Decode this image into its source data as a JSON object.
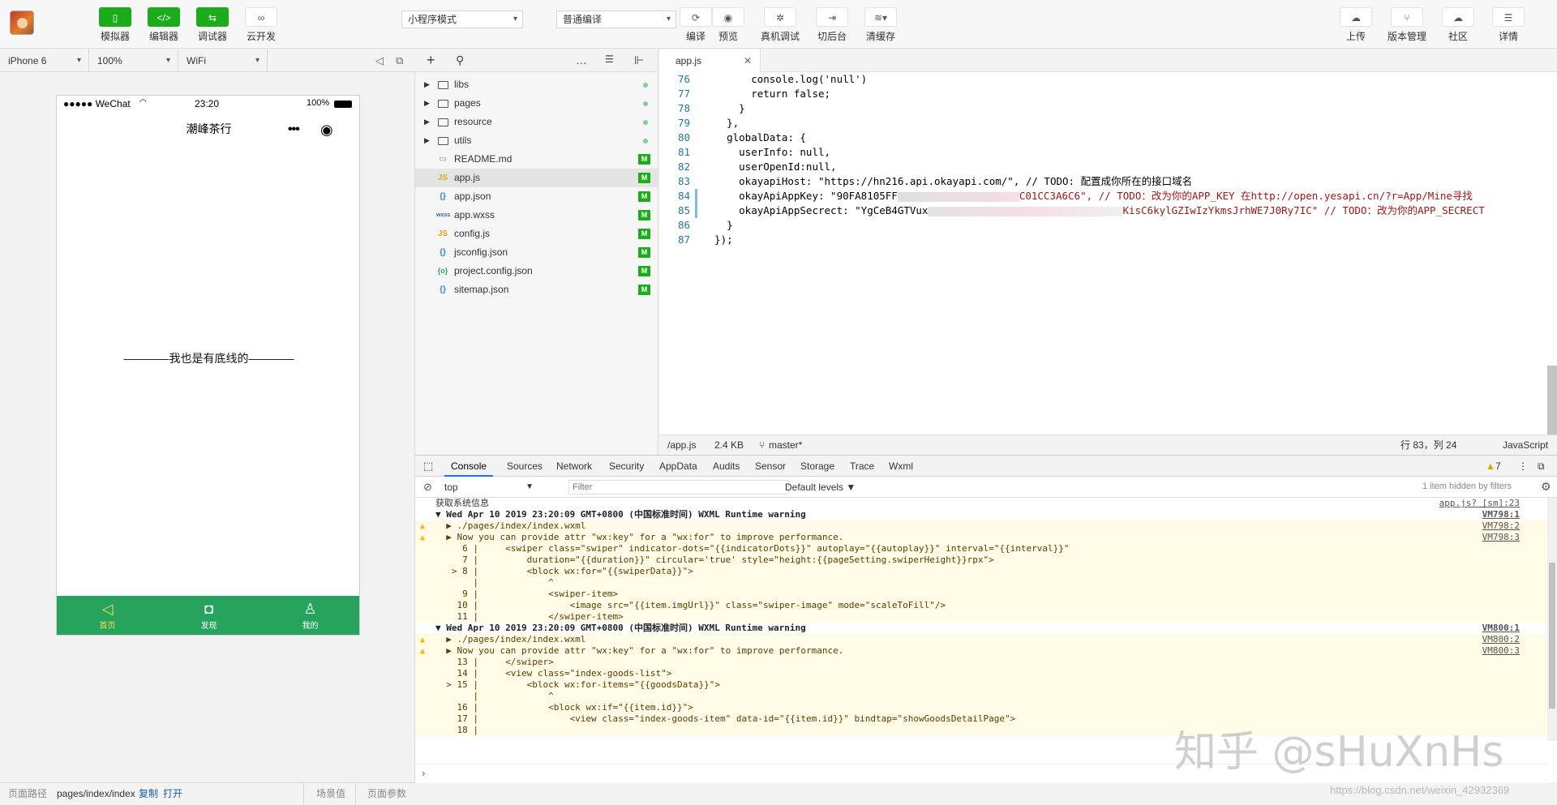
{
  "toolbar": {
    "buttons": [
      "模拟器",
      "编辑器",
      "调试器",
      "云开发"
    ],
    "mode_select": "小程序模式",
    "compile_select": "普通编译",
    "actions": [
      "编译",
      "预览",
      "真机调试",
      "切后台",
      "清缓存"
    ],
    "right_actions": [
      "上传",
      "版本管理",
      "社区",
      "详情"
    ]
  },
  "device": {
    "model": "iPhone 6",
    "zoom": "100%",
    "network": "WiFi"
  },
  "phone": {
    "status_carrier": "●●●●● WeChat",
    "status_time": "23:20",
    "status_battery": "100%",
    "nav_title": "潮峰茶行",
    "center_text": "————我也是有底线的————",
    "tabs": [
      "首页",
      "发现",
      "我的"
    ]
  },
  "sim_footer": {
    "label": "页面路径",
    "path": "pages/index/index",
    "copy": "复制",
    "open": "打开",
    "scene": "场景值",
    "params": "页面参数"
  },
  "explorer": {
    "folders": [
      "libs",
      "pages",
      "resource",
      "utils"
    ],
    "files": [
      {
        "name": "README.md",
        "icon": ""
      },
      {
        "name": "app.js",
        "icon": "JS"
      },
      {
        "name": "app.json",
        "icon": "{}"
      },
      {
        "name": "app.wxss",
        "icon": "wxss"
      },
      {
        "name": "config.js",
        "icon": "JS"
      },
      {
        "name": "jsconfig.json",
        "icon": "{}"
      },
      {
        "name": "project.config.json",
        "icon": "{o}"
      },
      {
        "name": "sitemap.json",
        "icon": "{}"
      }
    ],
    "badge": "M"
  },
  "editor": {
    "tab": "app.js",
    "line_numbers": [
      "76",
      "77",
      "78",
      "79",
      "80",
      "81",
      "82",
      "83",
      "84",
      "85",
      "86",
      "87"
    ],
    "lines": [
      "        console.log('null')",
      "        return false;",
      "      }",
      "    },",
      "    globalData: {",
      "      userInfo: null,",
      "      userOpenId:null,",
      "      okayapiHost: \"https://hn216.api.okayapi.com/\", // TODO: 配置成你所在的接口域名",
      "      okayApiAppKey: \"90FA8105FF",
      "      okayApiAppSecrect: \"YgCeB4GTVux",
      "    }",
      "  });"
    ],
    "line84_rest": "C01CC3A6C6\", // TODO：改为你的APP_KEY 在http://open.yesapi.cn/?r=App/Mine寻找",
    "line85_rest": "KisC6kylGZIwIzYkmsJrhWE7J0Ry7IC\" // TODO：改为你的APP_SECRECT",
    "status": {
      "path": "/app.js",
      "size": "2.4 KB",
      "branch": "master*",
      "position": "行 83，列 24",
      "lang": "JavaScript"
    }
  },
  "devtools": {
    "tabs": [
      "Console",
      "Sources",
      "Network",
      "Security",
      "AppData",
      "Audits",
      "Sensor",
      "Storage",
      "Trace",
      "Wxml"
    ],
    "warn_count": "7",
    "context": "top",
    "filter_placeholder": "Filter",
    "levels": "Default levels",
    "hidden": "1 item hidden by filters",
    "console": [
      {
        "t": "获取系统信息",
        "src": "app.js? [sm]:23",
        "k": "plain"
      },
      {
        "t": "▼ Wed Apr 10 2019 23:20:09 GMT+0800 (中国标准时间) WXML Runtime warning",
        "src": "VM798:1",
        "k": "hdr"
      },
      {
        "t": "  ▶ ./pages/index/index.wxml",
        "src": "VM798:2",
        "k": "warn"
      },
      {
        "t": "  ▶ Now you can provide attr \"wx:key\" for a \"wx:for\" to improve performance.",
        "src": "VM798:3",
        "k": "warn"
      },
      {
        "t": "     6 |     <swiper class=\"swiper\" indicator-dots=\"{{indicatorDots}}\" autoplay=\"{{autoplay}}\" interval=\"{{interval}}\"",
        "src": "",
        "k": "warn"
      },
      {
        "t": "     7 |         duration=\"{{duration}}\" circular='true' style=\"height:{{pageSetting.swiperHeight}}rpx\">",
        "src": "",
        "k": "warn"
      },
      {
        "t": "   > 8 |         <block wx:for=\"{{swiperData}}\">",
        "src": "",
        "k": "warn"
      },
      {
        "t": "       |             ^",
        "src": "",
        "k": "warn"
      },
      {
        "t": "     9 |             <swiper-item>",
        "src": "",
        "k": "warn"
      },
      {
        "t": "    10 |                 <image src=\"{{item.imgUrl}}\" class=\"swiper-image\" mode=\"scaleToFill\"/>",
        "src": "",
        "k": "warn"
      },
      {
        "t": "    11 |             </swiper-item>",
        "src": "",
        "k": "warn"
      },
      {
        "t": "▼ Wed Apr 10 2019 23:20:09 GMT+0800 (中国标准时间) WXML Runtime warning",
        "src": "VM800:1",
        "k": "hdr"
      },
      {
        "t": "  ▶ ./pages/index/index.wxml",
        "src": "VM800:2",
        "k": "warn"
      },
      {
        "t": "  ▶ Now you can provide attr \"wx:key\" for a \"wx:for\" to improve performance.",
        "src": "VM800:3",
        "k": "warn"
      },
      {
        "t": "    13 |     </swiper>",
        "src": "",
        "k": "warn"
      },
      {
        "t": "    14 |     <view class=\"index-goods-list\">",
        "src": "",
        "k": "warn"
      },
      {
        "t": "  > 15 |         <block wx:for-items=\"{{goodsData}}\">",
        "src": "",
        "k": "warn"
      },
      {
        "t": "       |             ^",
        "src": "",
        "k": "warn"
      },
      {
        "t": "    16 |             <block wx:if=\"{{item.id}}\">",
        "src": "",
        "k": "warn"
      },
      {
        "t": "    17 |                 <view class=\"index-goods-item\" data-id=\"{{item.id}}\" bindtap=\"showGoodsDetailPage\">",
        "src": "",
        "k": "warn"
      },
      {
        "t": "    18 |",
        "src": "",
        "k": "warn"
      }
    ]
  },
  "watermark": "知乎 @sHuXnHs",
  "watermark_url": "https://blog.csdn.net/weixin_42932369"
}
